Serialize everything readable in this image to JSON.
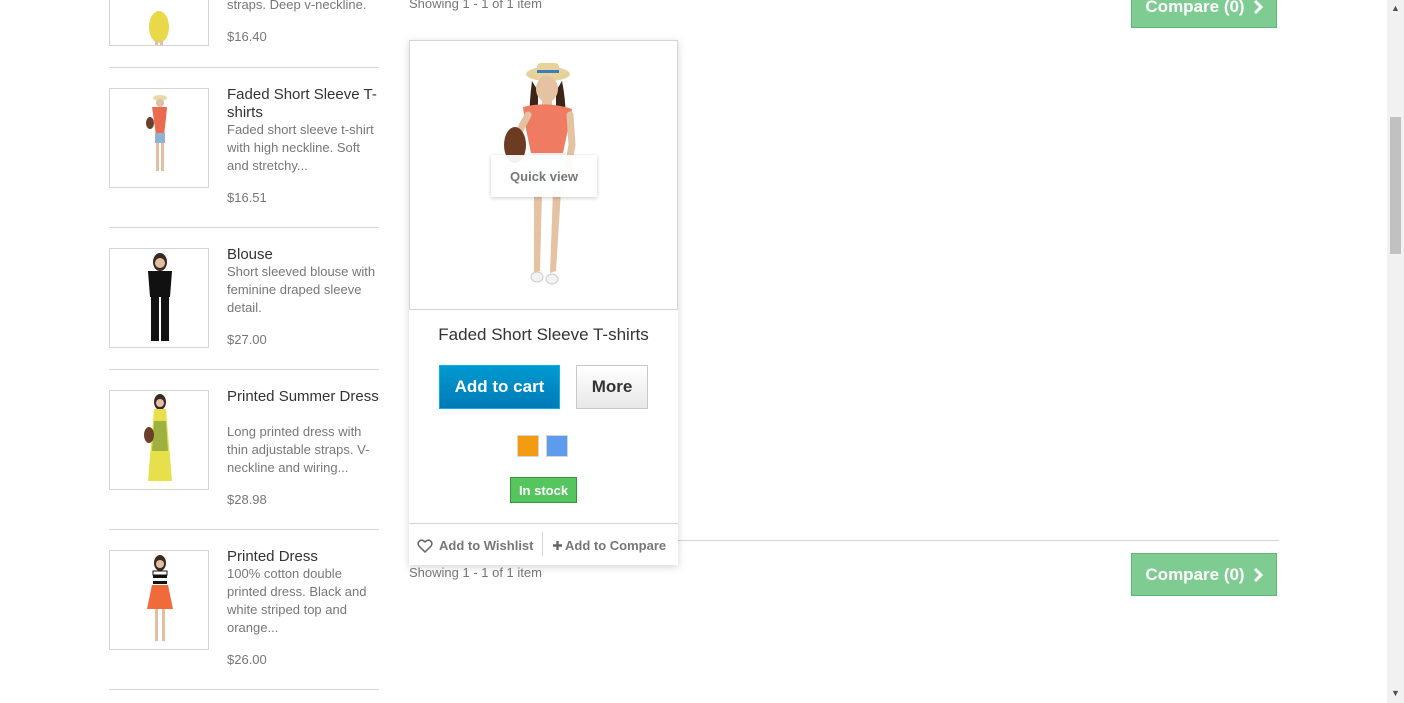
{
  "sidebar": {
    "items": [
      {
        "name": "",
        "desc": "straps. Deep v-neckline.",
        "price": "$16.40"
      },
      {
        "name": "Faded Short Sleeve T-shirts",
        "desc": "Faded short sleeve t-shirt with high neckline. Soft and stretchy...",
        "price": "$16.51"
      },
      {
        "name": "Blouse",
        "desc": "Short sleeved blouse with feminine draped sleeve detail.",
        "price": "$27.00"
      },
      {
        "name": "Printed Summer Dress",
        "desc": "Long printed dress with thin adjustable straps. V-neckline and wiring...",
        "price": "$28.98"
      },
      {
        "name": "Printed Dress",
        "desc": "100% cotton double printed dress. Black and white striped top and orange...",
        "price": "$26.00"
      }
    ]
  },
  "listing": {
    "showing_top": "Showing 1 - 1 of 1 item",
    "showing_bottom": "Showing 1 - 1 of 1 item",
    "compare_label": "Compare (0)"
  },
  "product": {
    "name": "Faded Short Sleeve T-shirts",
    "quick_view": "Quick view",
    "add_to_cart": "Add to cart",
    "more": "More",
    "colors": [
      "#f39c11",
      "#5d9cec"
    ],
    "availability": "In stock",
    "wishlist": "Add to Wishlist",
    "compare": "Add to Compare"
  },
  "colors": {
    "accent_blue": "#0079b6",
    "compare_green": "#7fcc92",
    "stock_green": "#55c65e"
  }
}
